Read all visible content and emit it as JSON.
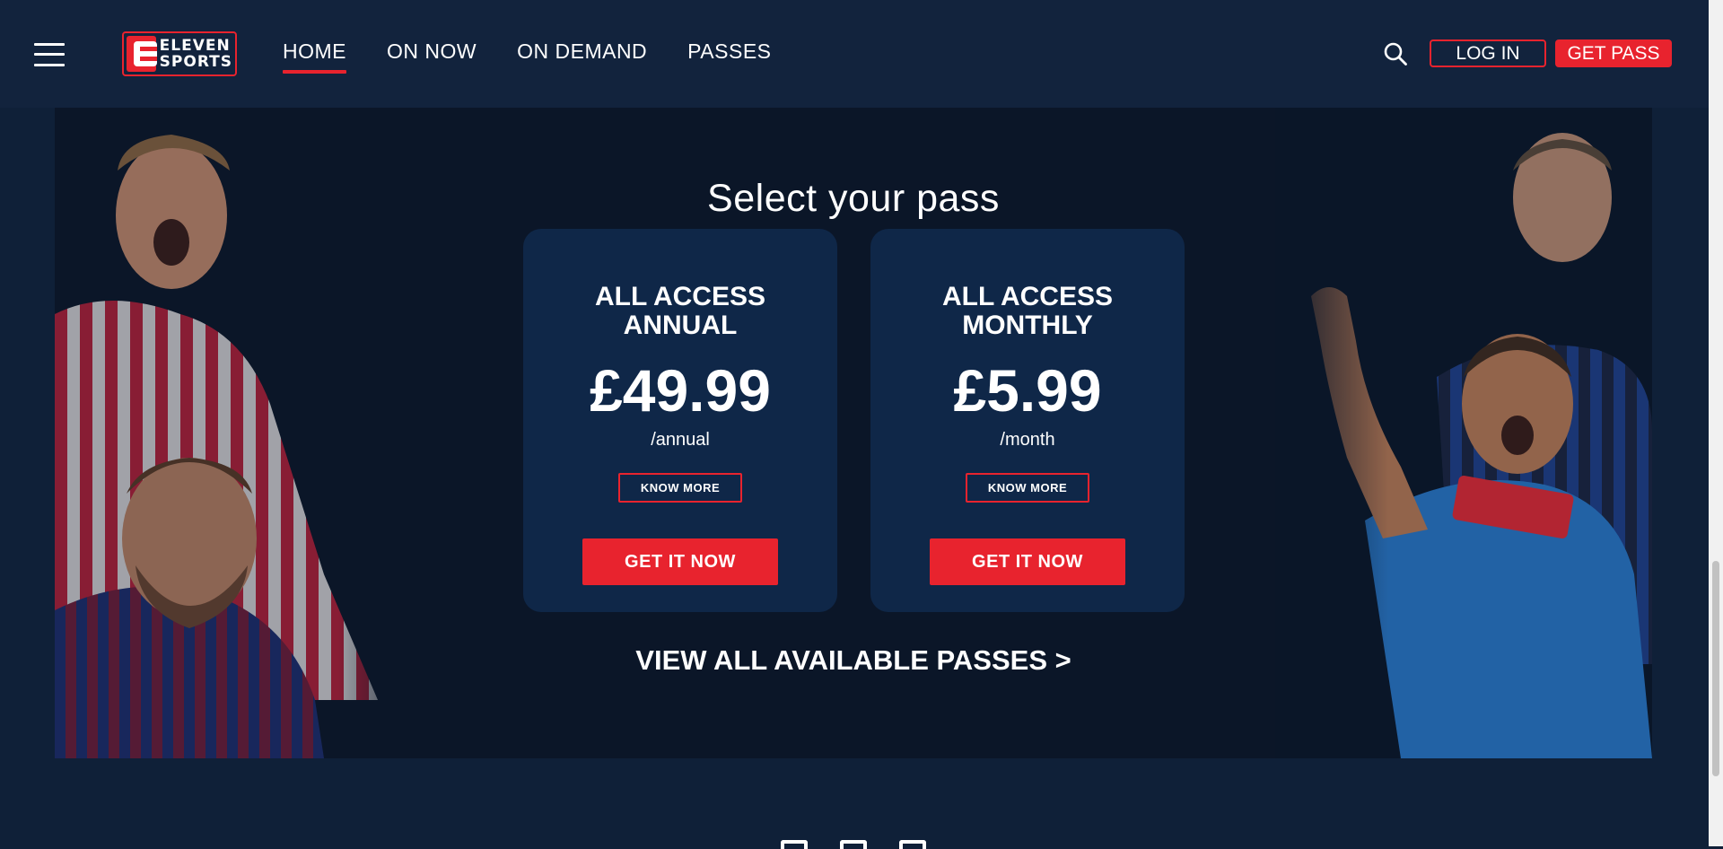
{
  "header": {
    "logo": {
      "line1": "ELEVEN",
      "line2": "SPORTS"
    },
    "nav": [
      {
        "label": "HOME",
        "active": true
      },
      {
        "label": "ON NOW",
        "active": false
      },
      {
        "label": "ON DEMAND",
        "active": false
      },
      {
        "label": "PASSES",
        "active": false
      }
    ],
    "search_icon": "search-icon",
    "login_label": "LOG IN",
    "get_pass_label": "GET PASS"
  },
  "passes": {
    "title": "Select your pass",
    "cards": [
      {
        "title_line1": "ALL ACCESS",
        "title_line2": "ANNUAL",
        "price": "£49.99",
        "period": "/annual",
        "know_more": "KNOW MORE",
        "cta": "GET IT NOW"
      },
      {
        "title_line1": "ALL ACCESS",
        "title_line2": "MONTHLY",
        "price": "£5.99",
        "period": "/month",
        "know_more": "KNOW MORE",
        "cta": "GET IT NOW"
      }
    ],
    "view_all": "VIEW ALL AVAILABLE PASSES >"
  },
  "footer": {
    "icons": [
      "facebook-icon",
      "instagram-icon",
      "twitter-icon"
    ]
  },
  "colors": {
    "accent": "#e8232e",
    "header_bg": "#12233d",
    "panel_bg": "#0b1628",
    "card_bg": "#0f2748"
  }
}
